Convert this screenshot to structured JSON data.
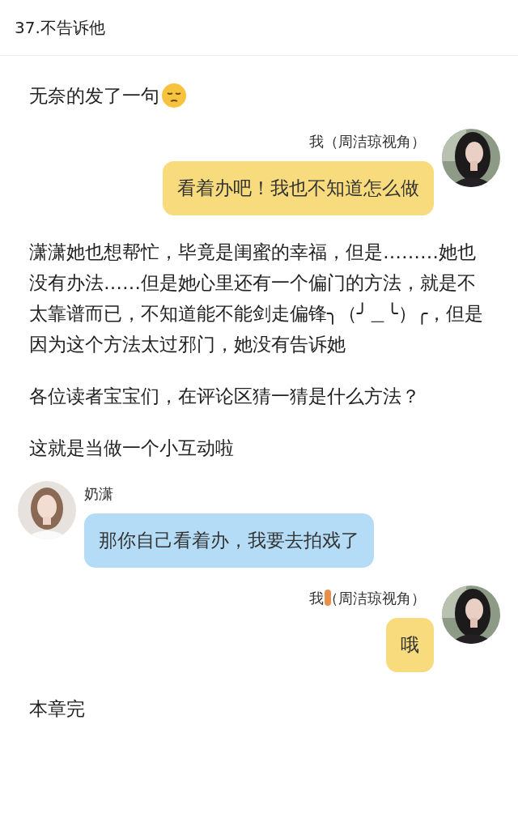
{
  "header": {
    "title": "37.不告诉他"
  },
  "blocks": [
    {
      "kind": "text",
      "text": "无奈的发了一句",
      "emoji": true
    },
    {
      "kind": "sent",
      "sender": "我（周洁琼视角）",
      "text": "看着办吧！我也不知道怎么做",
      "smudge": false
    },
    {
      "kind": "text",
      "text": "潇潇她也想帮忙，毕竟是闺蜜的幸福，但是………她也没有办法……但是她心里还有一个偏门的方法，就是不太靠谱而已，不知道能不能剑走偏锋╮（╯＿╰）╭，但是因为这个方法太过邪门，她没有告诉她",
      "emoji": false
    },
    {
      "kind": "text",
      "text": "各位读者宝宝们，在评论区猜一猜是什么方法？",
      "emoji": false
    },
    {
      "kind": "text",
      "text": "这就是当做一个小互动啦",
      "emoji": false
    },
    {
      "kind": "received",
      "sender": "奶潇",
      "text": "那你自己看着办，我要去拍戏了",
      "smudge": false
    },
    {
      "kind": "sent",
      "sender": "我（周洁琼视角）",
      "text": "哦",
      "smudge": true
    },
    {
      "kind": "text",
      "text": "本章完",
      "emoji": false
    }
  ]
}
